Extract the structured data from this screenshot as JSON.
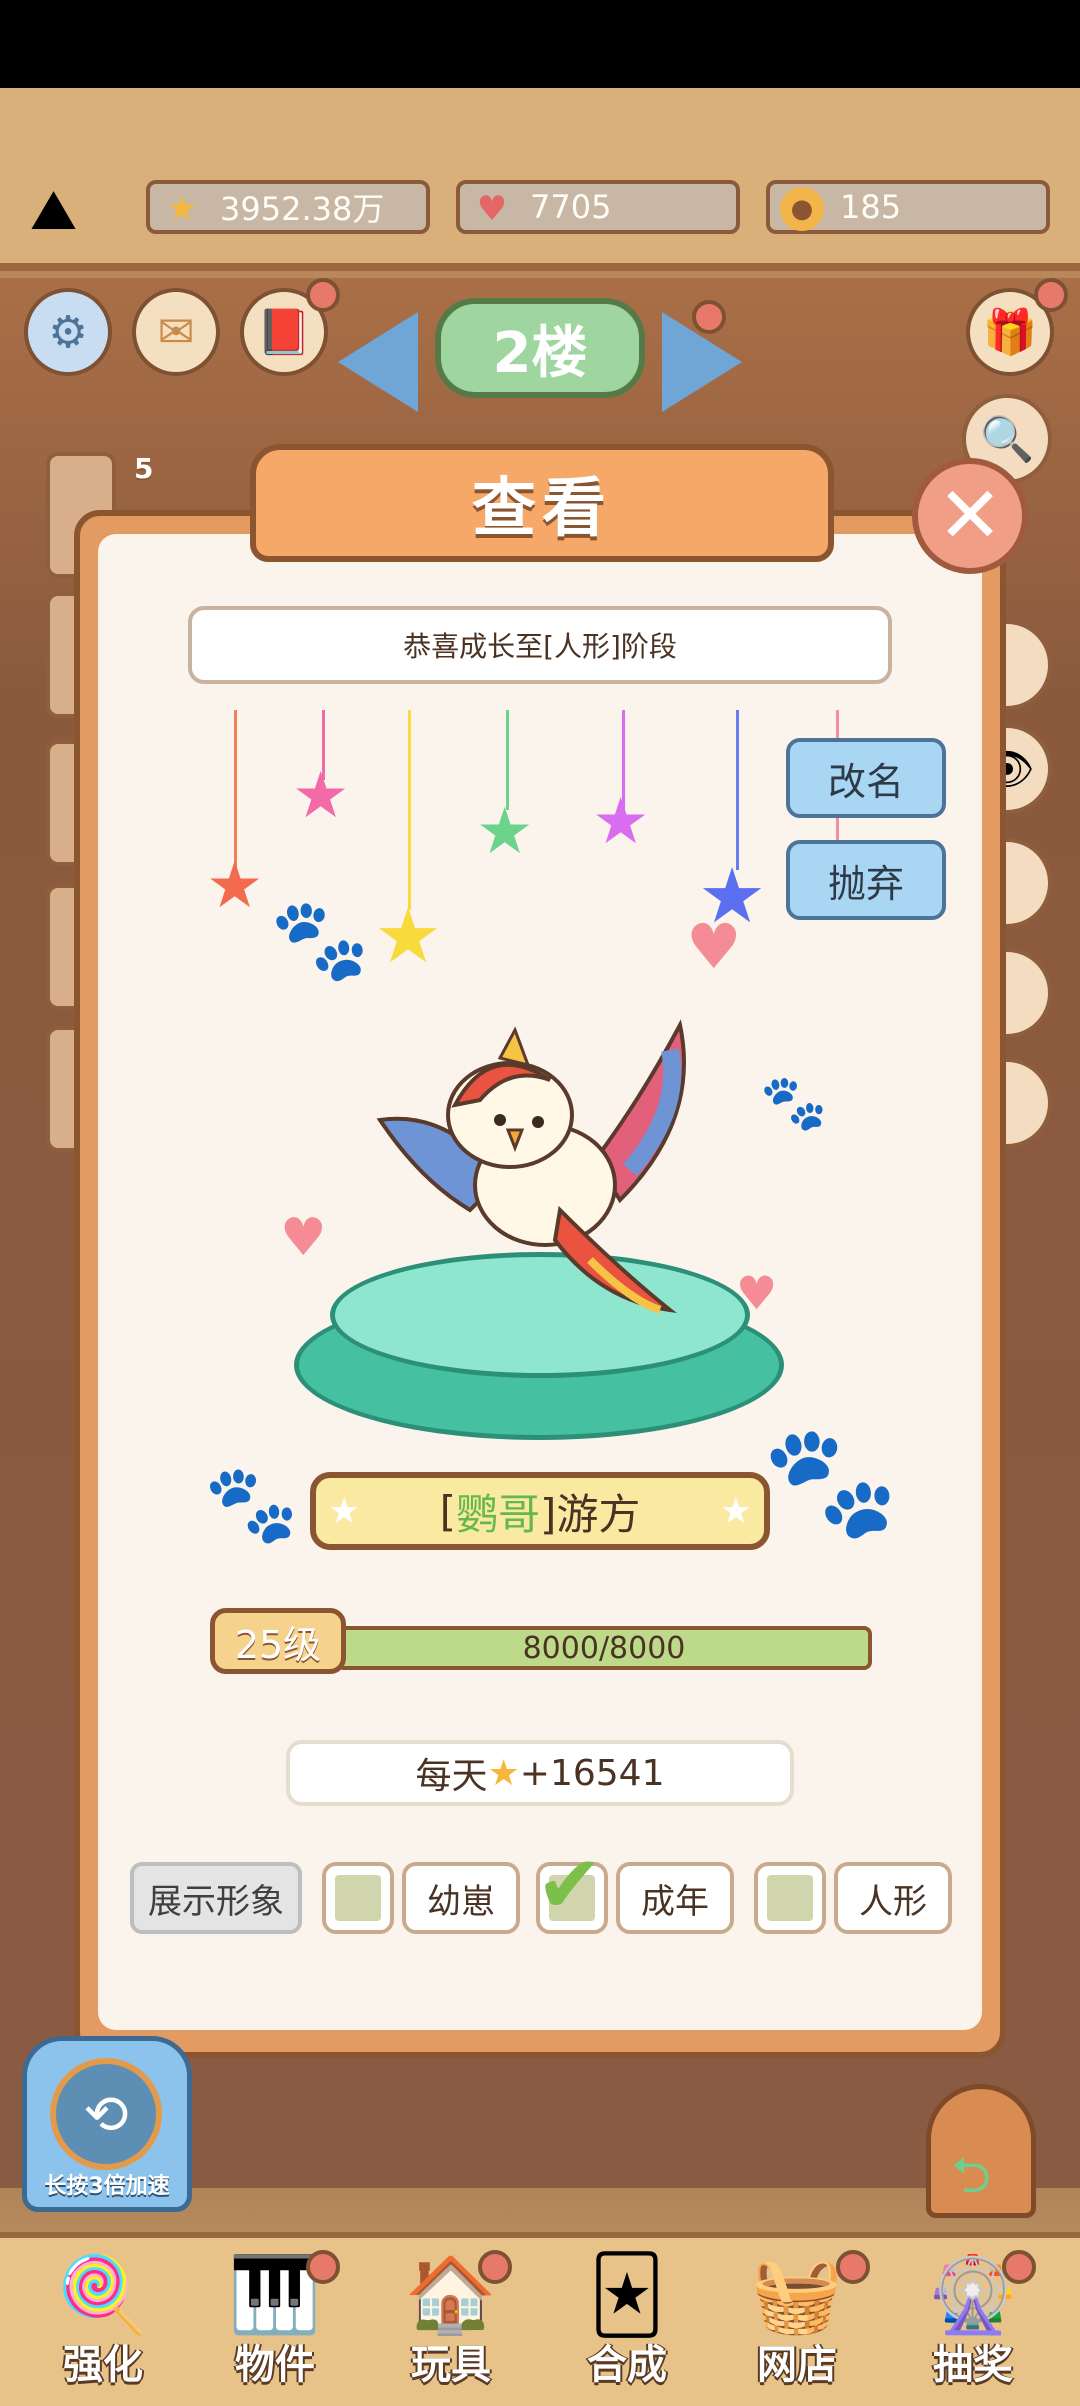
{
  "currencies": [
    {
      "icon": "star-icon",
      "value": "3952.38万"
    },
    {
      "icon": "heart-icon",
      "value": "7705"
    },
    {
      "icon": "paw-coin-icon",
      "value": "185"
    }
  ],
  "floor": {
    "label": "2楼"
  },
  "dialog": {
    "title": "查看",
    "message": "恭喜成长至[人形]阶段",
    "rename_label": "改名",
    "abandon_label": "抛弃",
    "pet_name_prefix": "[",
    "pet_name_species": "鹦哥",
    "pet_name_suffix": "]游方",
    "level": "25级",
    "xp": "8000/8000",
    "xp_fraction": 1.0,
    "daily_prefix": "每天",
    "daily_value": "+16541",
    "show_image_label": "展示形象",
    "stages": [
      {
        "label": "幼崽",
        "checked": false
      },
      {
        "label": "成年",
        "checked": true
      },
      {
        "label": "人形",
        "checked": false
      }
    ]
  },
  "side_panel": {
    "badge": "5"
  },
  "speed_button": {
    "label": "长按3倍加速"
  },
  "nav": [
    {
      "label": "强化",
      "icon": "lollipop-icon"
    },
    {
      "label": "物件",
      "icon": "piano-icon"
    },
    {
      "label": "玩具",
      "icon": "cat-house-icon"
    },
    {
      "label": "合成",
      "icon": "merge-cards-icon"
    },
    {
      "label": "网店",
      "icon": "shop-basket-icon"
    },
    {
      "label": "抽奖",
      "icon": "lottery-wheel-icon"
    }
  ],
  "colors": {
    "accent": "#e39b62",
    "xp_bar": "#bdd98a",
    "name_green": "#67b84c"
  }
}
